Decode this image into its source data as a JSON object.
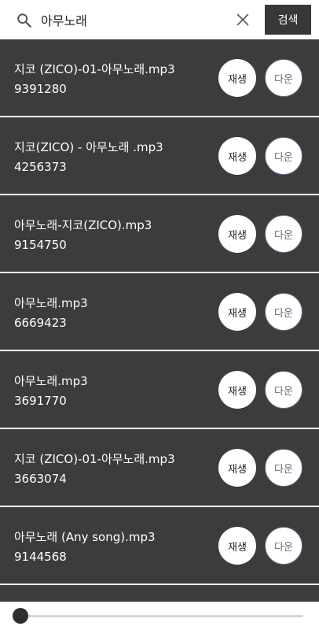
{
  "search": {
    "value": "아무노래",
    "button_label": "검색",
    "icons": {
      "search": "search-icon",
      "clear": "close-icon"
    }
  },
  "results": [
    {
      "title": "지코 (ZICO)-01-아무노래.mp3",
      "size": "9391280",
      "play_label": "재생",
      "download_label": "다운"
    },
    {
      "title": "지코(ZICO) - 아무노래 .mp3",
      "size": "4256373",
      "play_label": "재생",
      "download_label": "다운"
    },
    {
      "title": "아무노래-지코(ZICO).mp3",
      "size": "9154750",
      "play_label": "재생",
      "download_label": "다운"
    },
    {
      "title": "아무노래.mp3",
      "size": "6669423",
      "play_label": "재생",
      "download_label": "다운"
    },
    {
      "title": "아무노래.mp3",
      "size": "3691770",
      "play_label": "재생",
      "download_label": "다운"
    },
    {
      "title": "지코 (ZICO)-01-아무노래.mp3",
      "size": "3663074",
      "play_label": "재생",
      "download_label": "다운"
    },
    {
      "title": "아무노래 (Any song).mp3",
      "size": "9144568",
      "play_label": "재생",
      "download_label": "다운"
    }
  ],
  "player": {
    "progress": 0
  },
  "colors": {
    "row_background": "#3c3c3c",
    "search_button_background": "#383838",
    "slider_thumb": "#2e2e2e"
  }
}
